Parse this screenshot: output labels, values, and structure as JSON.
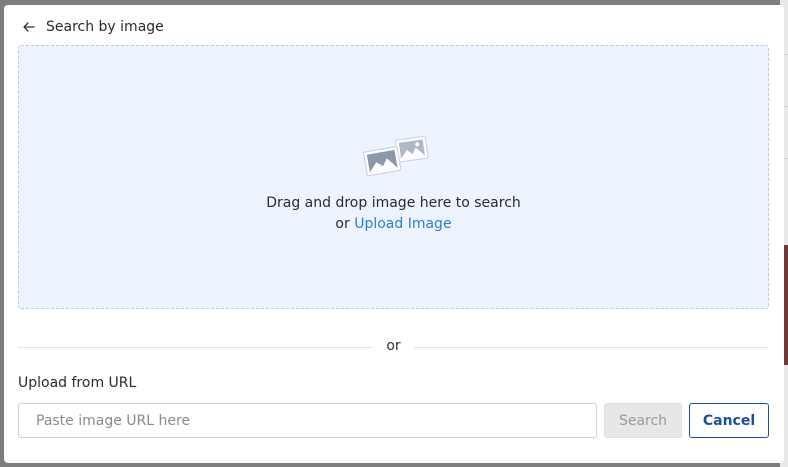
{
  "header": {
    "title": "Search by image",
    "back_icon": "arrow-left-icon"
  },
  "dropzone": {
    "illustration_icon": "images-icon",
    "drag_text": "Drag and drop image here to search",
    "or_prefix": "or",
    "upload_link": "Upload Image"
  },
  "divider": {
    "text": "or"
  },
  "url_section": {
    "label": "Upload from URL",
    "input_value": "",
    "input_placeholder": "Paste image URL here",
    "search_label": "Search",
    "cancel_label": "Cancel"
  },
  "colors": {
    "accent": "#2a7fd4",
    "cancel_border": "#1d4f9c",
    "dropzone_bg": "#eef4fd"
  }
}
